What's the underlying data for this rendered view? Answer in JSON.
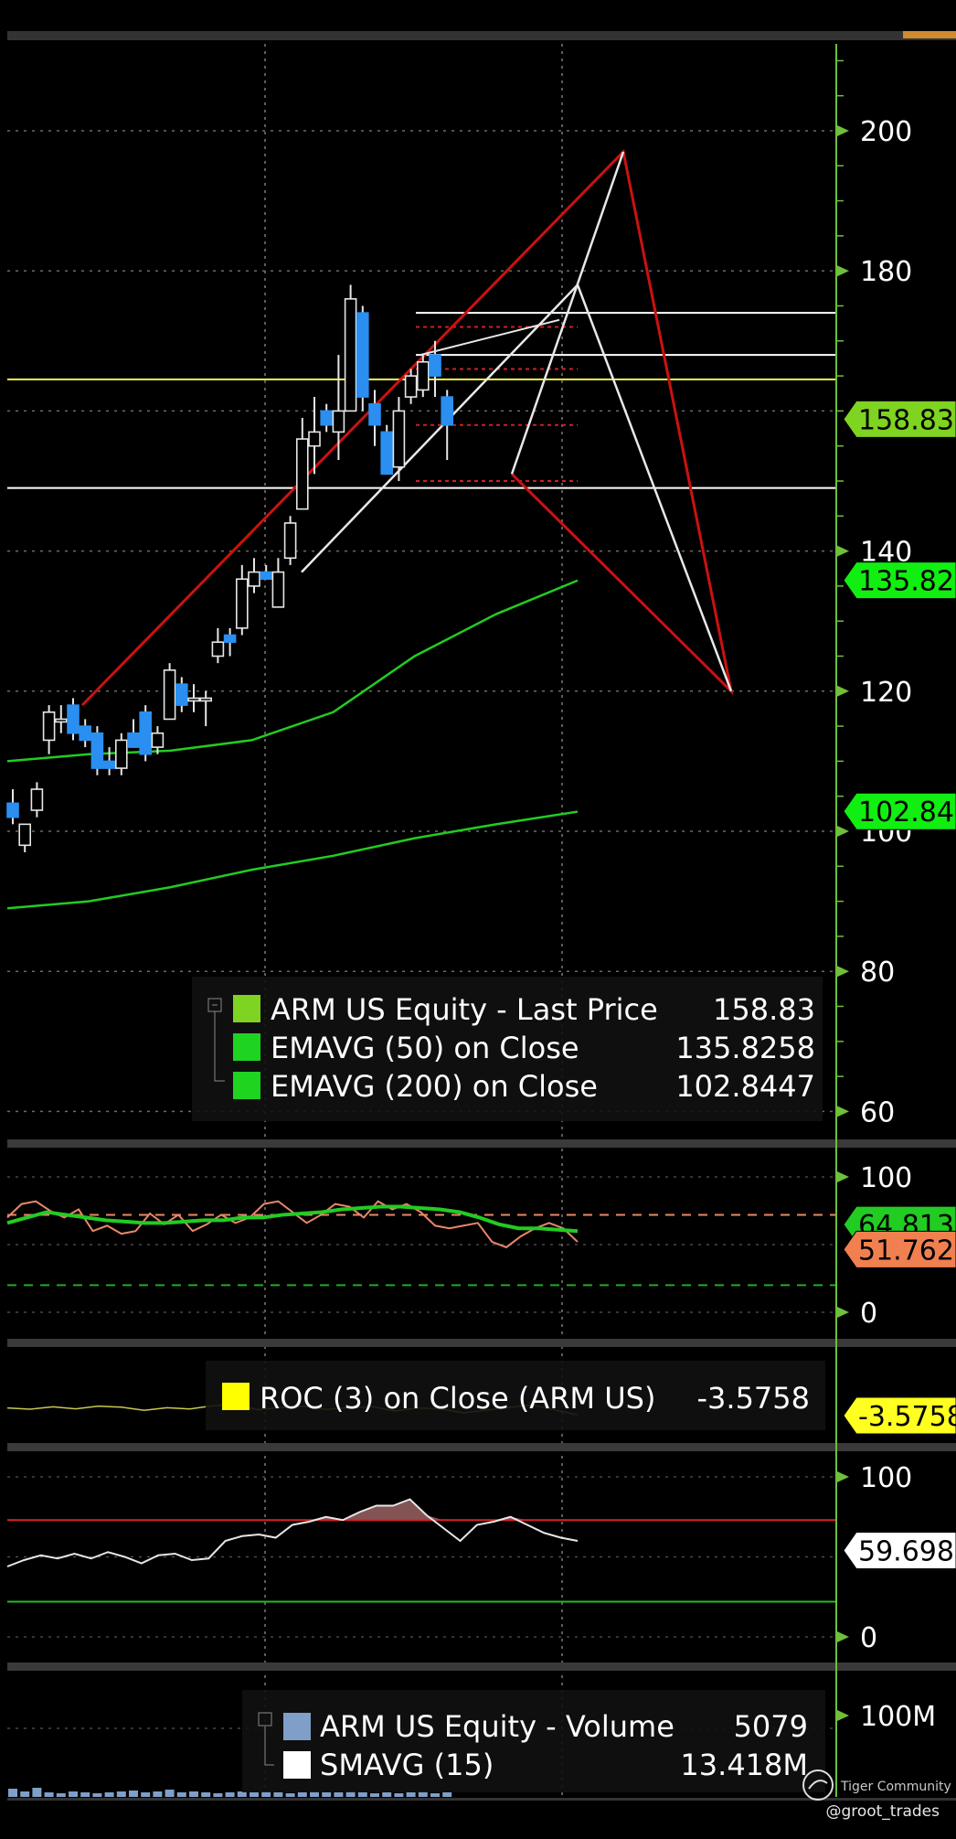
{
  "ticker": "ARM US",
  "price_panel": {
    "y_ticks": [
      200,
      180,
      140,
      120,
      100,
      80,
      60
    ],
    "ylim": [
      58,
      212
    ],
    "legend": [
      {
        "name": "ARM US Equity - Last Price",
        "value": "158.83",
        "color": "#7fd321"
      },
      {
        "name": "EMAVG (50)  on Close",
        "value": "135.8258",
        "color": "#1fd321"
      },
      {
        "name": "EMAVG (200)  on Close",
        "value": "102.8447",
        "color": "#1fd321"
      }
    ],
    "price_tags": [
      {
        "text": "158.83",
        "value": 158.83,
        "bg": "#7fd321"
      },
      {
        "text": "135.825",
        "value": 135.825,
        "bg": "#11ee11"
      },
      {
        "text": "102.844",
        "value": 102.844,
        "bg": "#11ee11"
      }
    ],
    "horizontal_levels": [
      {
        "value": 174,
        "color": "#ffffff"
      },
      {
        "value": 168,
        "color": "#ffffff"
      },
      {
        "value": 164.5,
        "color": "#f0f050"
      },
      {
        "value": 149,
        "color": "#ffffff"
      }
    ]
  },
  "chart_data": [
    {
      "type": "candlestick",
      "title": "ARM US Equity - Last Price",
      "last": 158.83,
      "ylim": [
        58,
        212
      ],
      "candles": [
        {
          "o": 104,
          "h": 106,
          "l": 101,
          "c": 102
        },
        {
          "o": 98,
          "h": 101,
          "l": 97,
          "c": 101
        },
        {
          "o": 103,
          "h": 107,
          "l": 102,
          "c": 106
        },
        {
          "o": 113,
          "h": 118,
          "l": 111,
          "c": 117
        },
        {
          "o": 116,
          "h": 118,
          "l": 114,
          "c": 116
        },
        {
          "o": 118,
          "h": 119,
          "l": 113,
          "c": 114
        },
        {
          "o": 115,
          "h": 116,
          "l": 112,
          "c": 113
        },
        {
          "o": 114,
          "h": 115,
          "l": 108,
          "c": 109
        },
        {
          "o": 110,
          "h": 112,
          "l": 108,
          "c": 109
        },
        {
          "o": 109,
          "h": 114,
          "l": 108,
          "c": 113
        },
        {
          "o": 114,
          "h": 116,
          "l": 112,
          "c": 112
        },
        {
          "o": 117,
          "h": 118,
          "l": 110,
          "c": 111
        },
        {
          "o": 112,
          "h": 115,
          "l": 111,
          "c": 114
        },
        {
          "o": 116,
          "h": 124,
          "l": 116,
          "c": 123
        },
        {
          "o": 121,
          "h": 122,
          "l": 117,
          "c": 118
        },
        {
          "o": 119,
          "h": 121,
          "l": 117,
          "c": 119
        },
        {
          "o": 119,
          "h": 120,
          "l": 115,
          "c": 119
        },
        {
          "o": 125,
          "h": 129,
          "l": 124,
          "c": 127
        },
        {
          "o": 128,
          "h": 129,
          "l": 125,
          "c": 127
        },
        {
          "o": 129,
          "h": 138,
          "l": 128,
          "c": 136
        },
        {
          "o": 135,
          "h": 139,
          "l": 134,
          "c": 137
        },
        {
          "o": 137,
          "h": 138,
          "l": 136,
          "c": 136
        },
        {
          "o": 132,
          "h": 139,
          "l": 132,
          "c": 137
        },
        {
          "o": 139,
          "h": 145,
          "l": 138,
          "c": 144
        },
        {
          "o": 146,
          "h": 159,
          "l": 146,
          "c": 156
        },
        {
          "o": 155,
          "h": 162,
          "l": 151,
          "c": 157
        },
        {
          "o": 160,
          "h": 161,
          "l": 157,
          "c": 158
        },
        {
          "o": 157,
          "h": 168,
          "l": 153,
          "c": 160
        },
        {
          "o": 160,
          "h": 178,
          "l": 160,
          "c": 176
        },
        {
          "o": 174,
          "h": 175,
          "l": 160,
          "c": 162
        },
        {
          "o": 161,
          "h": 163,
          "l": 155,
          "c": 158
        },
        {
          "o": 157,
          "h": 158,
          "l": 151,
          "c": 151
        },
        {
          "o": 152,
          "h": 162,
          "l": 150,
          "c": 160
        },
        {
          "o": 162,
          "h": 166,
          "l": 161,
          "c": 165
        },
        {
          "o": 163,
          "h": 168,
          "l": 162,
          "c": 167
        },
        {
          "o": 168,
          "h": 170,
          "l": 162,
          "c": 165
        },
        {
          "o": 162,
          "h": 163,
          "l": 153,
          "c": 158
        }
      ],
      "series": [
        {
          "name": "EMAVG (50)  on Close",
          "values": [
            110,
            111,
            111.5,
            113,
            117,
            125,
            131,
            135.8
          ]
        },
        {
          "name": "EMAVG (200)  on Close",
          "values": [
            89,
            90,
            92,
            94.5,
            96.5,
            99,
            101,
            102.8
          ]
        }
      ]
    },
    {
      "type": "line",
      "ylim": [
        0,
        100
      ],
      "y_ticks": [
        100,
        0
      ],
      "tags": [
        {
          "text": "64.8133",
          "value": 64.8,
          "bg": "#22cc22"
        },
        {
          "text": "51.762",
          "value": 51.8,
          "bg": "#f08050"
        }
      ],
      "series": [
        {
          "name": "",
          "values": [
            70,
            80,
            82,
            75,
            70,
            76,
            60,
            64,
            58,
            60,
            73,
            65,
            72,
            60,
            65,
            72,
            66,
            70,
            80,
            82,
            74,
            66,
            72,
            80,
            78,
            70,
            82,
            76,
            80,
            74,
            64,
            62,
            64,
            66,
            52,
            48,
            56,
            62,
            66,
            62,
            52
          ]
        },
        {
          "name": "",
          "values": [
            66,
            70,
            74,
            72,
            70,
            68,
            67,
            66,
            66,
            67,
            68,
            68,
            70,
            70,
            72,
            73,
            74,
            76,
            77,
            78,
            78,
            77,
            76,
            74,
            70,
            65,
            62,
            62,
            61,
            60
          ]
        }
      ],
      "levels": [
        {
          "value": 72,
          "color": "#e8876a"
        },
        {
          "value": 20,
          "color": "#22aa22"
        }
      ]
    },
    {
      "type": "line",
      "legend": [
        {
          "name": "ROC (3)  on Close (ARM US)",
          "value": "-3.5758",
          "color": "#ffff00"
        }
      ],
      "tags": [
        {
          "text": "-3.5758",
          "bg": "#ffff20"
        }
      ],
      "series": [
        {
          "name": "ROC (3)  on Close (ARM US)",
          "values": [
            0.2,
            -0.5,
            0.8,
            -0.3,
            1.2,
            0.6,
            -1.1,
            0.3,
            -0.4,
            1.4,
            2.0,
            -0.8,
            0.5,
            1.1,
            -0.6,
            0.4,
            0.9,
            -1.5,
            0.2,
            -0.3,
            -2.5,
            -1.0,
            0.5,
            1.8,
            -0.9,
            -3.6
          ]
        }
      ]
    },
    {
      "type": "line",
      "ylim": [
        0,
        100
      ],
      "y_ticks": [
        100,
        0
      ],
      "tags": [
        {
          "text": "59.6987",
          "value": 59.7,
          "bg": "#ffffff"
        }
      ],
      "series": [
        {
          "name": "",
          "values": [
            44,
            48,
            51,
            49,
            52,
            49,
            53,
            50,
            46,
            51,
            52,
            48,
            49,
            60,
            63,
            64,
            62,
            70,
            72,
            75,
            73,
            78,
            82,
            82,
            86,
            76,
            68,
            60,
            70,
            72,
            75,
            70,
            65,
            62,
            60
          ]
        }
      ],
      "levels": [
        {
          "value": 73,
          "color": "#dd2222"
        },
        {
          "value": 22,
          "color": "#22bb22"
        }
      ]
    },
    {
      "type": "bar",
      "y_ticks": [
        "100M"
      ],
      "legend": [
        {
          "name": "ARM US Equity - Volume",
          "value": "5079",
          "color": "#7f9fc8"
        },
        {
          "name": "SMAVG (15)",
          "value": "13.418M",
          "color": "#ffffff"
        }
      ],
      "values": [
        9,
        6,
        10,
        5,
        4,
        6,
        5,
        4,
        5,
        6,
        7,
        5,
        6,
        8,
        5,
        6,
        5,
        4,
        5,
        6,
        5,
        6,
        5,
        4,
        5,
        6,
        5,
        5,
        6,
        5,
        4,
        5,
        4,
        5,
        6,
        4,
        5
      ]
    }
  ],
  "watermark": {
    "text": "Tiger Community"
  },
  "credit": "@groot_trades"
}
